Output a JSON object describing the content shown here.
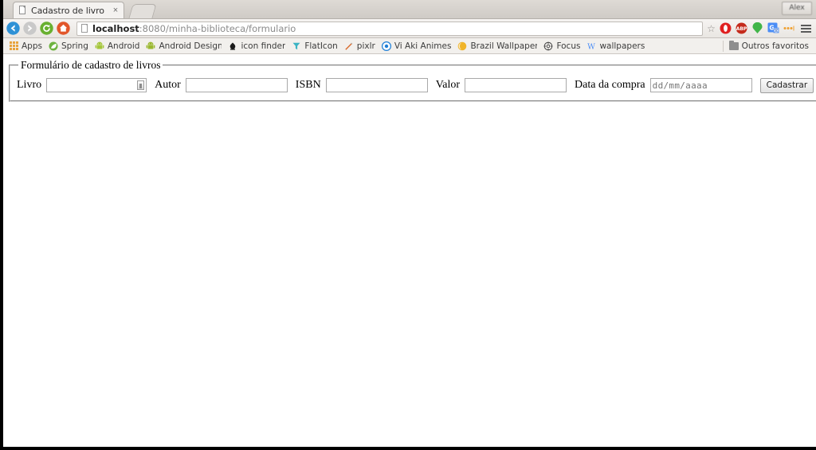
{
  "window": {
    "badge_label": "Alex"
  },
  "tab": {
    "title": "Cadastro de livro",
    "close_label": "×",
    "favicon": "page-icon"
  },
  "toolbar": {
    "back_icon": "back-arrow-icon",
    "forward_icon": "forward-arrow-icon",
    "reload_icon": "reload-icon",
    "home_icon": "home-icon",
    "url_bold": "localhost",
    "url_rest": ":8080/minha-biblioteca/formulario",
    "star_icon": "☆",
    "extensions": [
      {
        "name": "opera-extension-icon",
        "color": "#e02020",
        "glyph": "O"
      },
      {
        "name": "adblock-plus-icon",
        "color": "#c42b1c",
        "glyph": "ABP"
      },
      {
        "name": "green-pin-icon",
        "color": "#41b549",
        "glyph": ""
      },
      {
        "name": "google-translate-icon",
        "color": "#4a8df6",
        "glyph": "G"
      },
      {
        "name": "more-dots-icon",
        "color": "#f0a030",
        "glyph": "•••"
      }
    ],
    "menu_icon": "hamburger-menu-icon"
  },
  "bookmarks": {
    "items": [
      {
        "label": "Apps",
        "icon": "apps-grid-icon",
        "color": "#e8a33d"
      },
      {
        "label": "Spring",
        "icon": "spring-leaf-icon",
        "color": "#6db33f"
      },
      {
        "label": "Android",
        "icon": "android-robot-icon",
        "color": "#a4c639"
      },
      {
        "label": "Android Design Sup",
        "icon": "android-robot-icon",
        "color": "#a4c639"
      },
      {
        "label": "icon finder",
        "icon": "iconfinder-icon",
        "color": "#1a1a1a"
      },
      {
        "label": "FlatIcon",
        "icon": "flaticon-icon",
        "color": "#3cb4c4"
      },
      {
        "label": "pixlr",
        "icon": "pixlr-pencil-icon",
        "color": "#d96a2b"
      },
      {
        "label": "Vi Aki Animes",
        "icon": "viakianimes-icon",
        "color": "#1f7fd6"
      },
      {
        "label": "Brazil Wallpapers ·",
        "icon": "brazil-wallpapers-icon",
        "color": "#f0b429"
      },
      {
        "label": "Focus",
        "icon": "focus-icon",
        "color": "#4a4a4a"
      },
      {
        "label": "wallpapers",
        "icon": "wallpapers-w-icon",
        "color": "#4a8df6"
      }
    ],
    "other_folder_label": "Outros favoritos",
    "other_folder_icon": "folder-icon"
  },
  "form": {
    "legend": "Formulário de cadastro de livros",
    "fields": [
      {
        "label": "Livro",
        "value": "",
        "placeholder": "",
        "name": "livro"
      },
      {
        "label": "Autor",
        "value": "",
        "placeholder": "",
        "name": "autor"
      },
      {
        "label": "ISBN",
        "value": "",
        "placeholder": "",
        "name": "isbn"
      },
      {
        "label": "Valor",
        "value": "",
        "placeholder": "",
        "name": "valor"
      },
      {
        "label": "Data da compra",
        "value": "",
        "placeholder": "dd/mm/aaaa",
        "name": "data-da-compra"
      }
    ],
    "submit_label": "Cadastrar"
  }
}
